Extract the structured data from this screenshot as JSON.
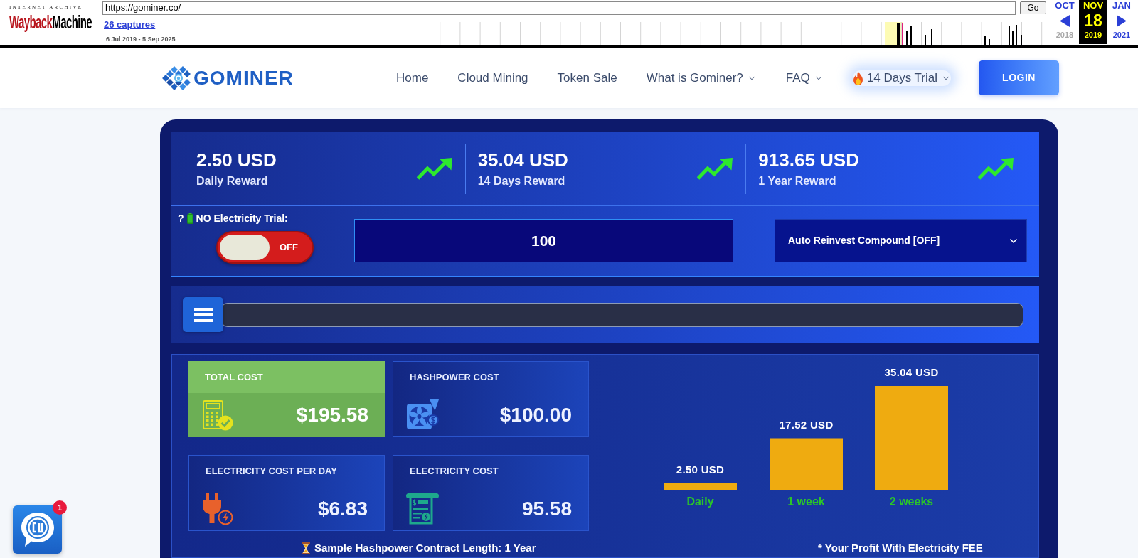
{
  "wayback": {
    "logo_top": "INTERNET ARCHIVE",
    "logo_primary": "Wayback",
    "logo_secondary": "Machine",
    "url": "https://gominer.co/",
    "go_button": "Go",
    "captures_link": "26 captures",
    "date_range": "6 Jul 2019 - 5 Sep 2025",
    "calendar": [
      {
        "month": "OCT",
        "year": "2018",
        "year_disabled": true,
        "selected": false
      },
      {
        "month": "NOV",
        "day": "18",
        "year": "2019",
        "year_disabled": false,
        "selected": true
      },
      {
        "month": "JAN",
        "year": "2021",
        "year_disabled": false,
        "selected": false
      }
    ]
  },
  "nav": {
    "logo_text": "GOMINER",
    "links": [
      {
        "label": "Home",
        "dropdown": false,
        "kind": "plain"
      },
      {
        "label": "Cloud Mining",
        "dropdown": false,
        "kind": "plain"
      },
      {
        "label": "Token Sale",
        "dropdown": false,
        "kind": "plain"
      },
      {
        "label": "What is Gominer?",
        "dropdown": true,
        "kind": "plain"
      },
      {
        "label": "FAQ",
        "dropdown": true,
        "kind": "plain"
      },
      {
        "label": "14 Days Trial",
        "dropdown": true,
        "kind": "promo"
      }
    ],
    "login_button": "LOGIN"
  },
  "rewards": [
    {
      "value": "2.50 USD",
      "label": "Daily Reward"
    },
    {
      "value": "35.04 USD",
      "label": "14 Days Reward"
    },
    {
      "value": "913.65 USD",
      "label": "1 Year Reward"
    }
  ],
  "trial": {
    "help_mark": "?",
    "label": "NO Electricity Trial:",
    "on": false,
    "state_text": "OFF"
  },
  "amount_input": {
    "value": "100"
  },
  "reinvest_select": {
    "value": "Auto Reinvest Compound [OFF]"
  },
  "slider": {
    "level": 0
  },
  "cost_cards": [
    {
      "kind": "total",
      "title": "TOTAL COST",
      "amount": "$195.58",
      "highlighted": true
    },
    {
      "kind": "hashpower",
      "title": "HASHPOWER COST",
      "amount": "$100.00",
      "highlighted": false
    },
    {
      "kind": "electricity-day",
      "title": "ELECTRICITY COST PER DAY",
      "amount": "$6.83",
      "highlighted": false
    },
    {
      "kind": "electricity",
      "title": "ELECTRICITY COST",
      "amount": "95.58",
      "highlighted": false
    }
  ],
  "profit_chart": {
    "chart_data": {
      "type": "bar",
      "categories": [
        "Daily",
        "1 week",
        "2 weeks"
      ],
      "values": [
        2.5,
        17.52,
        35.04
      ],
      "data_labels": true,
      "value_labels": [
        "2.50 USD",
        "17.52 USD",
        "35.04 USD"
      ]
    }
  },
  "contract_note": "Sample Hashpower Contract Length: 1 Year",
  "profit_note": "* Your Profit With Electricity FEE",
  "chat_widget": {
    "badge": "1"
  }
}
